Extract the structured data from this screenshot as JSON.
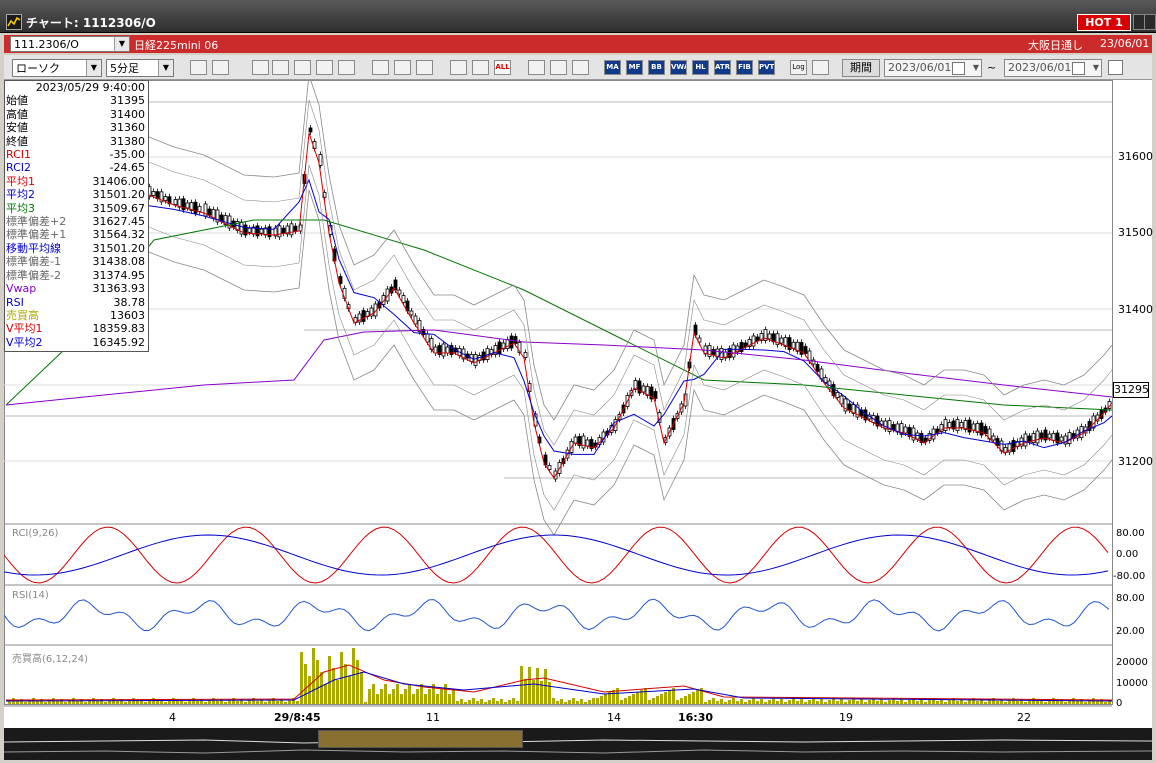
{
  "window": {
    "title": "チャート: 1112306/O",
    "hot_label": "HOT 1"
  },
  "toolbar1": {
    "code_value": "111.2306/O",
    "product_name": "日経225mini 06",
    "session": "大阪日通し",
    "date": "23/06/01"
  },
  "toolbar2": {
    "chart_type": "ローソク",
    "timeframe": "5分足",
    "period_button": "期間",
    "date_from": "2023/06/01",
    "date_to": "2023/06/01",
    "range_sep": "~",
    "icons": [
      "zoom-icon",
      "crosshair-icon",
      "download-icon",
      "zoom-in-icon",
      "trend-icon",
      "compare-icon",
      "dimmed-icon",
      "draw-line-icon",
      "cursor-icon",
      "undo-icon",
      "candle-icon",
      "candle2-icon",
      "all-icon",
      "gear-icon",
      "wrench-icon",
      "color-icon",
      "ma-icon",
      "mf-icon",
      "bb-icon",
      "vwap-icon",
      "hl-icon",
      "atr-icon",
      "fibo-icon",
      "pvt-icon",
      "log-icon",
      "export-icon"
    ],
    "icon_labels": [
      "",
      "",
      "",
      "",
      "",
      "",
      "",
      "",
      "",
      "",
      "",
      "",
      "ALL",
      "",
      "",
      "",
      "MA",
      "MF",
      "BB",
      "VWAP",
      "HL",
      "ATR",
      "FIB",
      "PVT",
      "Log",
      ""
    ]
  },
  "info": {
    "timestamp": "2023/05/29 9:40:00",
    "rows": [
      {
        "label": "始値",
        "value": "31395",
        "color": "#000000"
      },
      {
        "label": "高値",
        "value": "31400",
        "color": "#000000"
      },
      {
        "label": "安値",
        "value": "31360",
        "color": "#000000"
      },
      {
        "label": "終値",
        "value": "31380",
        "color": "#000000"
      },
      {
        "label": "RCI1",
        "value": "-35.00",
        "color": "#d40000"
      },
      {
        "label": "RCI2",
        "value": "-24.65",
        "color": "#0000cc"
      },
      {
        "label": "平均1",
        "value": "31406.00",
        "color": "#d40000"
      },
      {
        "label": "平均2",
        "value": "31501.20",
        "color": "#0000cc"
      },
      {
        "label": "平均3",
        "value": "31509.67",
        "color": "#007700"
      },
      {
        "label": "標準偏差+2",
        "value": "31627.45",
        "color": "#666666"
      },
      {
        "label": "標準偏差+1",
        "value": "31564.32",
        "color": "#666666"
      },
      {
        "label": "移動平均線",
        "value": "31501.20",
        "color": "#0000cc"
      },
      {
        "label": "標準偏差-1",
        "value": "31438.08",
        "color": "#666666"
      },
      {
        "label": "標準偏差-2",
        "value": "31374.95",
        "color": "#666666"
      },
      {
        "label": "Vwap",
        "value": "31363.93",
        "color": "#8800cc"
      },
      {
        "label": "RSI",
        "value": "38.78",
        "color": "#0000cc"
      },
      {
        "label": "売買高",
        "value": "13603",
        "color": "#aaaa00"
      },
      {
        "label": "V平均1",
        "value": "18359.83",
        "color": "#d40000"
      },
      {
        "label": "V平均2",
        "value": "16345.92",
        "color": "#0000cc"
      }
    ]
  },
  "price_axis": {
    "ticks": [
      "31600",
      "31500",
      "31400",
      "31300",
      "31200"
    ],
    "current": "31295"
  },
  "rci_axis": {
    "ticks": [
      "80.00",
      "0.00",
      "-80.00"
    ]
  },
  "rsi_axis": {
    "ticks": [
      "80.00",
      "20.00"
    ]
  },
  "vol_axis": {
    "ticks": [
      "20000",
      "10000",
      "0"
    ]
  },
  "panel_labels": {
    "rci": "RCI(9,26)",
    "rsi": "RSI(14)",
    "volume": "売買高(6,12,24)"
  },
  "x_axis": {
    "labels": [
      "4",
      "29/8:45",
      "11",
      "14",
      "16:30",
      "19",
      "22"
    ]
  },
  "colors": {
    "accent_red": "#cc2b2b",
    "title_bg": "#3a3a3a",
    "candle": "#000000",
    "ma1": "#d40000",
    "ma2": "#0000cc",
    "ma3": "#007700",
    "vwap": "#8800cc",
    "bands": "#888888",
    "volume": "#aaaa00"
  }
}
